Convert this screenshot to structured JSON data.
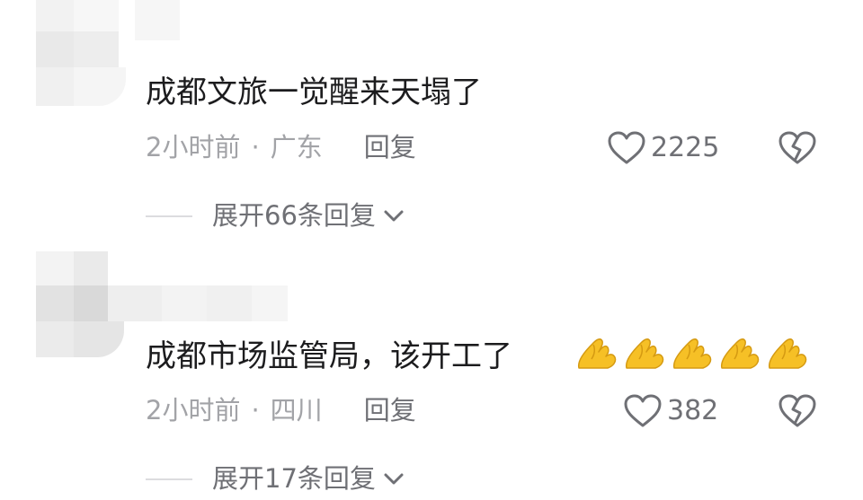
{
  "comments": [
    {
      "text": "成都文旅一觉醒来天塌了",
      "time": "2小时前",
      "separator": "·",
      "location": "广东",
      "reply_label": "回复",
      "likes": "2225",
      "expand_label": "展开66条回复",
      "emoji_count": 0
    },
    {
      "text": "成都市场监管局，该开工了",
      "time": "2小时前",
      "separator": "·",
      "location": "四川",
      "reply_label": "回复",
      "likes": "382",
      "expand_label": "展开17条回复",
      "emoji_count": 5
    }
  ],
  "icons": {
    "like": "heart-outline-icon",
    "dislike": "broken-heart-icon",
    "expand": "chevron-down-icon",
    "emoji": "palms-together-emoji"
  },
  "colors": {
    "text_primary": "#1c1c1e",
    "text_secondary": "#a2a3a7",
    "action": "#6f7075",
    "emoji": "#f6c026"
  }
}
